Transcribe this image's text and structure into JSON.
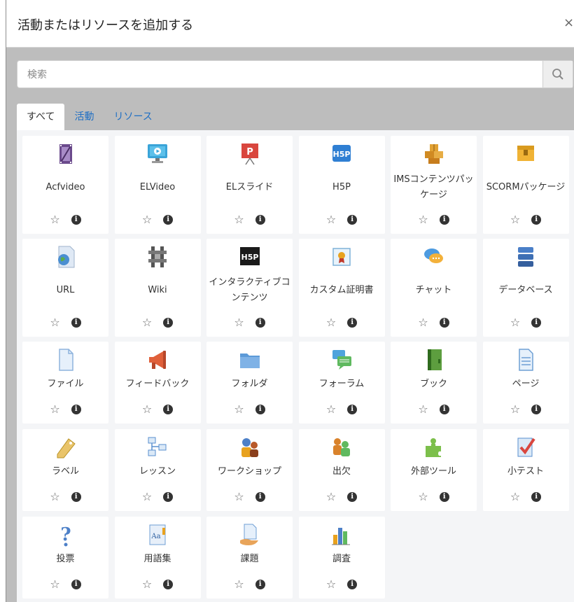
{
  "modal": {
    "title": "活動またはリソースを追加する",
    "close_glyph": "×"
  },
  "search": {
    "placeholder": "検索",
    "value": ""
  },
  "tabs": [
    {
      "label": "すべて",
      "active": true
    },
    {
      "label": "活動",
      "active": false
    },
    {
      "label": "リソース",
      "active": false
    }
  ],
  "items": [
    {
      "name": "Acfvideo",
      "icon": "film-icon"
    },
    {
      "name": "ELVideo",
      "icon": "monitor-play-icon"
    },
    {
      "name": "ELスライド",
      "icon": "presentation-board-icon"
    },
    {
      "name": "H5P",
      "icon": "h5p-icon"
    },
    {
      "name": "IMSコンテンツパッケージ",
      "icon": "ims-boxes-icon"
    },
    {
      "name": "SCORMパッケージ",
      "icon": "scorm-box-icon"
    },
    {
      "name": "URL",
      "icon": "url-globe-icon"
    },
    {
      "name": "Wiki",
      "icon": "wiki-icon"
    },
    {
      "name": "インタラクティブコンテンツ",
      "icon": "h5p-interactive-icon"
    },
    {
      "name": "カスタム証明書",
      "icon": "certificate-icon"
    },
    {
      "name": "チャット",
      "icon": "chat-bubbles-icon"
    },
    {
      "name": "データベース",
      "icon": "database-icon"
    },
    {
      "name": "ファイル",
      "icon": "file-icon"
    },
    {
      "name": "フィードバック",
      "icon": "megaphone-icon"
    },
    {
      "name": "フォルダ",
      "icon": "folder-icon"
    },
    {
      "name": "フォーラム",
      "icon": "forum-icon"
    },
    {
      "name": "ブック",
      "icon": "book-icon"
    },
    {
      "name": "ページ",
      "icon": "page-icon"
    },
    {
      "name": "ラベル",
      "icon": "label-tag-icon"
    },
    {
      "name": "レッスン",
      "icon": "lesson-icon"
    },
    {
      "name": "ワークショップ",
      "icon": "workshop-icon"
    },
    {
      "name": "出欠",
      "icon": "attendance-icon"
    },
    {
      "name": "外部ツール",
      "icon": "puzzle-icon"
    },
    {
      "name": "小テスト",
      "icon": "quiz-check-icon"
    },
    {
      "name": "投票",
      "icon": "question-icon"
    },
    {
      "name": "用語集",
      "icon": "glossary-icon"
    },
    {
      "name": "課題",
      "icon": "assignment-icon"
    },
    {
      "name": "調査",
      "icon": "survey-chart-icon"
    }
  ],
  "action_icons": {
    "star": "☆",
    "info": "i"
  }
}
